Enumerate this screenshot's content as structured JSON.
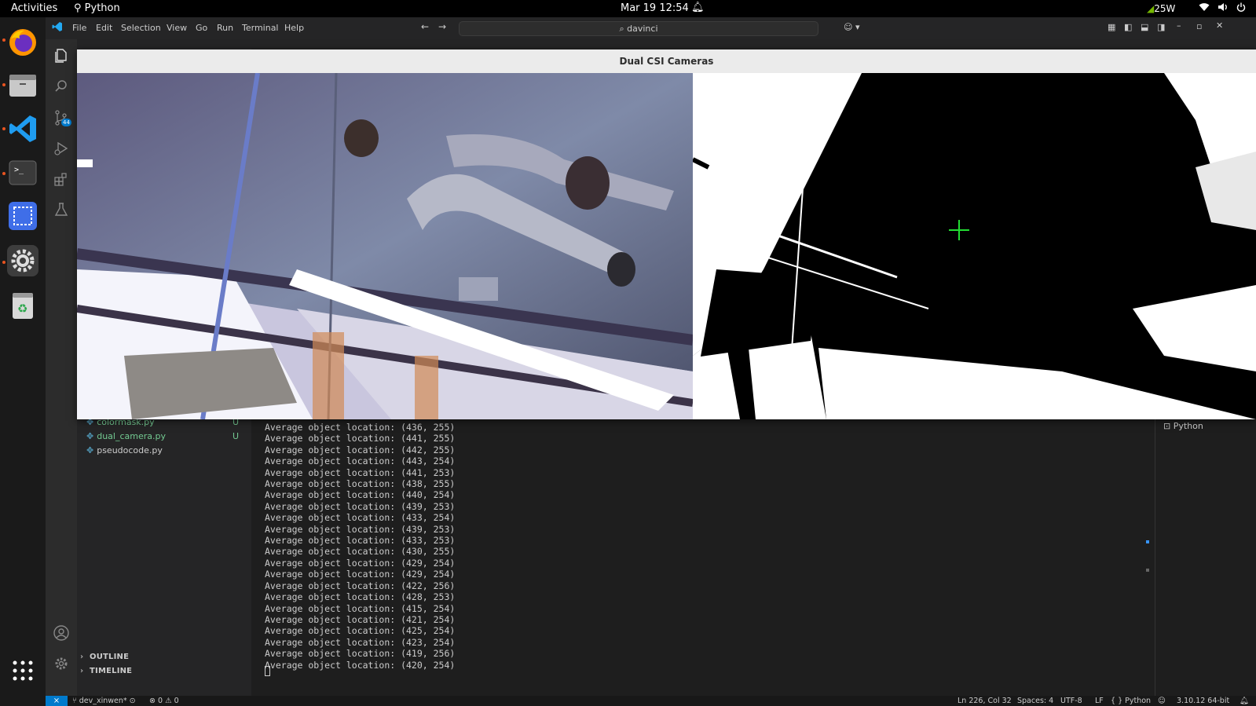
{
  "topbar": {
    "activities": "Activities",
    "app_name": "Python",
    "datetime": "Mar 19  12:54",
    "power": "25W"
  },
  "dock": {
    "items": [
      "firefox-icon",
      "files-icon",
      "vscode-icon",
      "terminal-icon",
      "screenshot-icon",
      "settings-icon",
      "trash-icon",
      "apps-grid-icon"
    ]
  },
  "vscode": {
    "menu": [
      "File",
      "Edit",
      "Selection",
      "View",
      "Go",
      "Run",
      "Terminal",
      "Help"
    ],
    "search_text": "davinci",
    "source_control_badge": "44",
    "explorer": {
      "files": [
        {
          "name": "colormask.py",
          "badge": "U"
        },
        {
          "name": "dual_camera.py",
          "badge": "U"
        },
        {
          "name": "pseudocode.py",
          "badge": ""
        }
      ],
      "sections": [
        "OUTLINE",
        "TIMELINE"
      ]
    },
    "terminal": {
      "tab_label": "Python",
      "lines": [
        "Average object location: (436, 255)",
        "Average object location: (441, 255)",
        "Average object location: (442, 255)",
        "Average object location: (443, 254)",
        "Average object location: (441, 253)",
        "Average object location: (438, 255)",
        "Average object location: (440, 254)",
        "Average object location: (439, 253)",
        "Average object location: (433, 254)",
        "Average object location: (439, 253)",
        "Average object location: (433, 253)",
        "Average object location: (430, 255)",
        "Average object location: (429, 254)",
        "Average object location: (429, 254)",
        "Average object location: (422, 256)",
        "Average object location: (428, 253)",
        "Average object location: (415, 254)",
        "Average object location: (421, 254)",
        "Average object location: (425, 254)",
        "Average object location: (423, 254)",
        "Average object location: (419, 256)",
        "Average object location: (420, 254)"
      ]
    },
    "statusbar": {
      "branch": "dev_xinwen*",
      "problems": "0",
      "warnings": "0",
      "position": "Ln 226, Col 32",
      "spaces": "Spaces: 4",
      "encoding": "UTF-8",
      "eol": "LF",
      "language": "Python",
      "interpreter": "3.10.12 64-bit"
    }
  },
  "camera_window": {
    "title": "Dual CSI Cameras"
  },
  "colors": {
    "vscode_blue": "#007acc",
    "ubuntu_orange": "#e95420",
    "crosshair": "#22dd33"
  }
}
